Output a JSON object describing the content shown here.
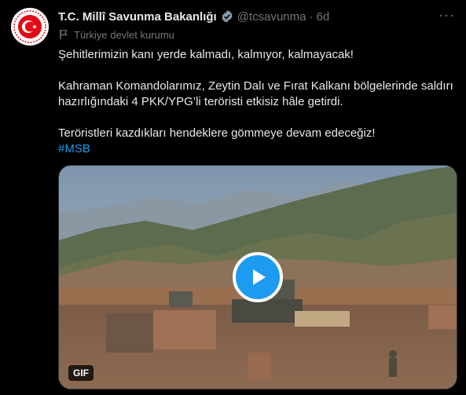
{
  "tweet": {
    "author_name": "T.C. Millî Savunma Bakanlığı",
    "handle": "@tcsavunma",
    "separator": "·",
    "time": "6d",
    "more_label": "···",
    "account_label": "Türkiye devlet kurumu",
    "line1": "Şehitlerimizin kanı yerde kalmadı, kalmıyor, kalmayacak!",
    "line2": "Kahraman Komandolarımız, Zeytin Dalı ve Fırat Kalkanı bölgelerinde saldırı hazırlığındaki 4 PKK/YPG’li teröristi etkisiz hâle getirdi.",
    "line3": "Teröristleri kazdıkları hendeklere gömmeye devam edeceğiz!",
    "hashtag": "#MSB",
    "media_badge": "GIF"
  },
  "icons": {
    "avatar": "ministry-crescent-star-seal",
    "verified": "verified-badge-icon",
    "label": "flag-icon",
    "play": "play-icon"
  },
  "colors": {
    "background": "#000000",
    "text": "#e7e9ea",
    "secondary": "#71767b",
    "accent": "#1d9bf0",
    "seal_red": "#e30a17"
  }
}
